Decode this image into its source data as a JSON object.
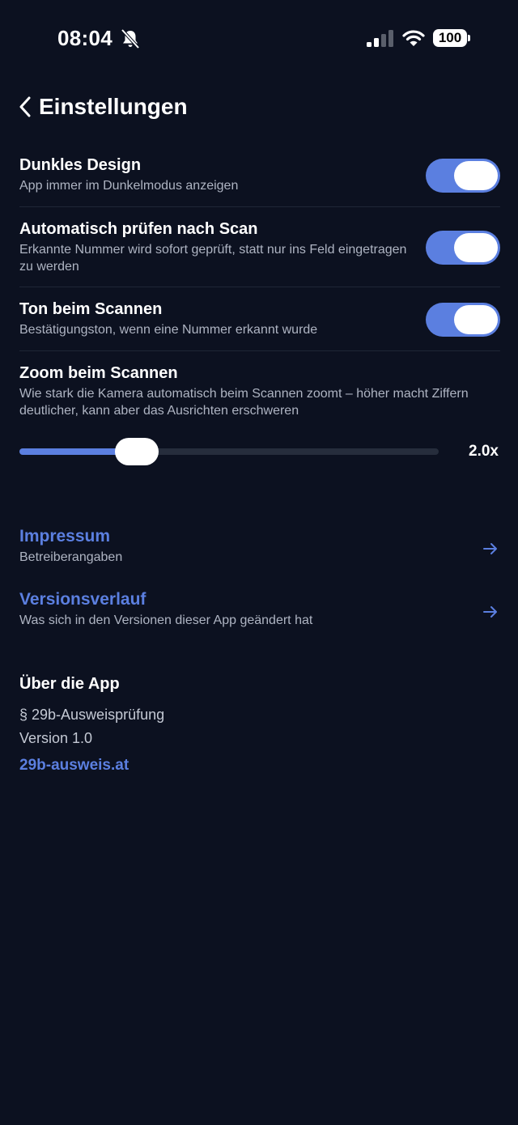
{
  "status_bar": {
    "time": "08:04",
    "battery": "100"
  },
  "header": {
    "title": "Einstellungen"
  },
  "settings": {
    "dark_mode": {
      "title": "Dunkles Design",
      "description": "App immer im Dunkelmodus anzeigen",
      "enabled": true
    },
    "auto_check": {
      "title": "Automatisch prüfen nach Scan",
      "description": "Erkannte Nummer wird sofort geprüft, statt nur ins Feld eingetragen zu werden",
      "enabled": true
    },
    "scan_sound": {
      "title": "Ton beim Scannen",
      "description": "Bestätigungston, wenn eine Nummer erkannt wurde",
      "enabled": true
    },
    "scan_zoom": {
      "title": "Zoom beim Scannen",
      "description": "Wie stark die Kamera automatisch beim Scannen zoomt – höher macht Ziffern deutlicher, kann aber das Ausrichten erschweren",
      "value_label": "2.0x",
      "slider_fraction": 0.28
    }
  },
  "links": {
    "impressum": {
      "title": "Impressum",
      "description": "Betreiberangaben"
    },
    "changelog": {
      "title": "Versionsverlauf",
      "description": "Was sich in den Versionen dieser App geändert hat"
    }
  },
  "about": {
    "title": "Über die App",
    "app_name": "§ 29b-Ausweisprüfung",
    "version": "Version 1.0",
    "website": "29b-ausweis.at"
  },
  "colors": {
    "background": "#0c1120",
    "accent": "#5b7fe0",
    "secondary_text": "#aeb4c2"
  }
}
